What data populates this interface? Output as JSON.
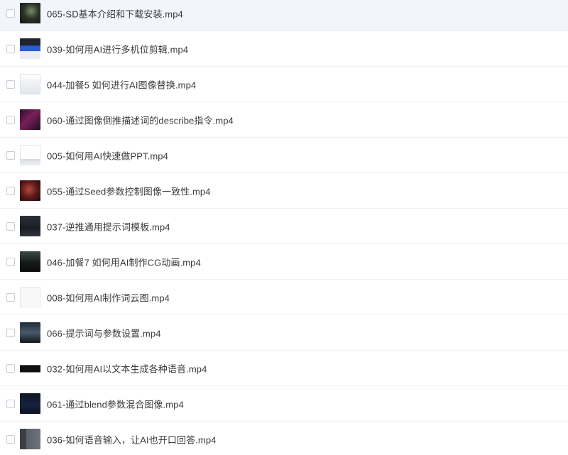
{
  "files": [
    {
      "name": "065-SD基本介绍和下载安装.mp4",
      "selected": false,
      "highlighted": true,
      "thumb": "dark-portrait"
    },
    {
      "name": "039-如何用AI进行多机位剪辑.mp4",
      "selected": false,
      "highlighted": false,
      "thumb": "editor-blue"
    },
    {
      "name": "044-加餐5 如何进行AI图像替换.mp4",
      "selected": false,
      "highlighted": false,
      "thumb": "light-ui"
    },
    {
      "name": "060-通过图像倒推描述词的describe指令.mp4",
      "selected": false,
      "highlighted": false,
      "thumb": "purple-art"
    },
    {
      "name": "005-如何用AI快速做PPT.mp4",
      "selected": false,
      "highlighted": false,
      "thumb": "white-slide"
    },
    {
      "name": "055-通过Seed参数控制图像一致性.mp4",
      "selected": false,
      "highlighted": false,
      "thumb": "red-portrait"
    },
    {
      "name": "037-逆推通用提示词模板.mp4",
      "selected": false,
      "highlighted": false,
      "thumb": "dark-terminal"
    },
    {
      "name": "046-加餐7 如何用AI制作CG动画.mp4",
      "selected": false,
      "highlighted": false,
      "thumb": "dark-scene"
    },
    {
      "name": "008-如何用AI制作词云图.mp4",
      "selected": false,
      "highlighted": false,
      "thumb": "white-doc"
    },
    {
      "name": "066-提示词与参数设置.mp4",
      "selected": false,
      "highlighted": false,
      "thumb": "dark-grid"
    },
    {
      "name": "032-如何用AI以文本生成各种语音.mp4",
      "selected": false,
      "highlighted": false,
      "thumb": "black-bar"
    },
    {
      "name": "061-通过blend参数混合图像.mp4",
      "selected": false,
      "highlighted": false,
      "thumb": "navy-app"
    },
    {
      "name": "036-如何语音输入，让AI也开口回答.mp4",
      "selected": false,
      "highlighted": false,
      "thumb": "gray-app"
    }
  ],
  "colors": {
    "row_highlight": "#f2f5fc",
    "row_divider": "#eef0f4",
    "text": "#3a3a3a",
    "checkbox_border": "#c9ccd4"
  }
}
